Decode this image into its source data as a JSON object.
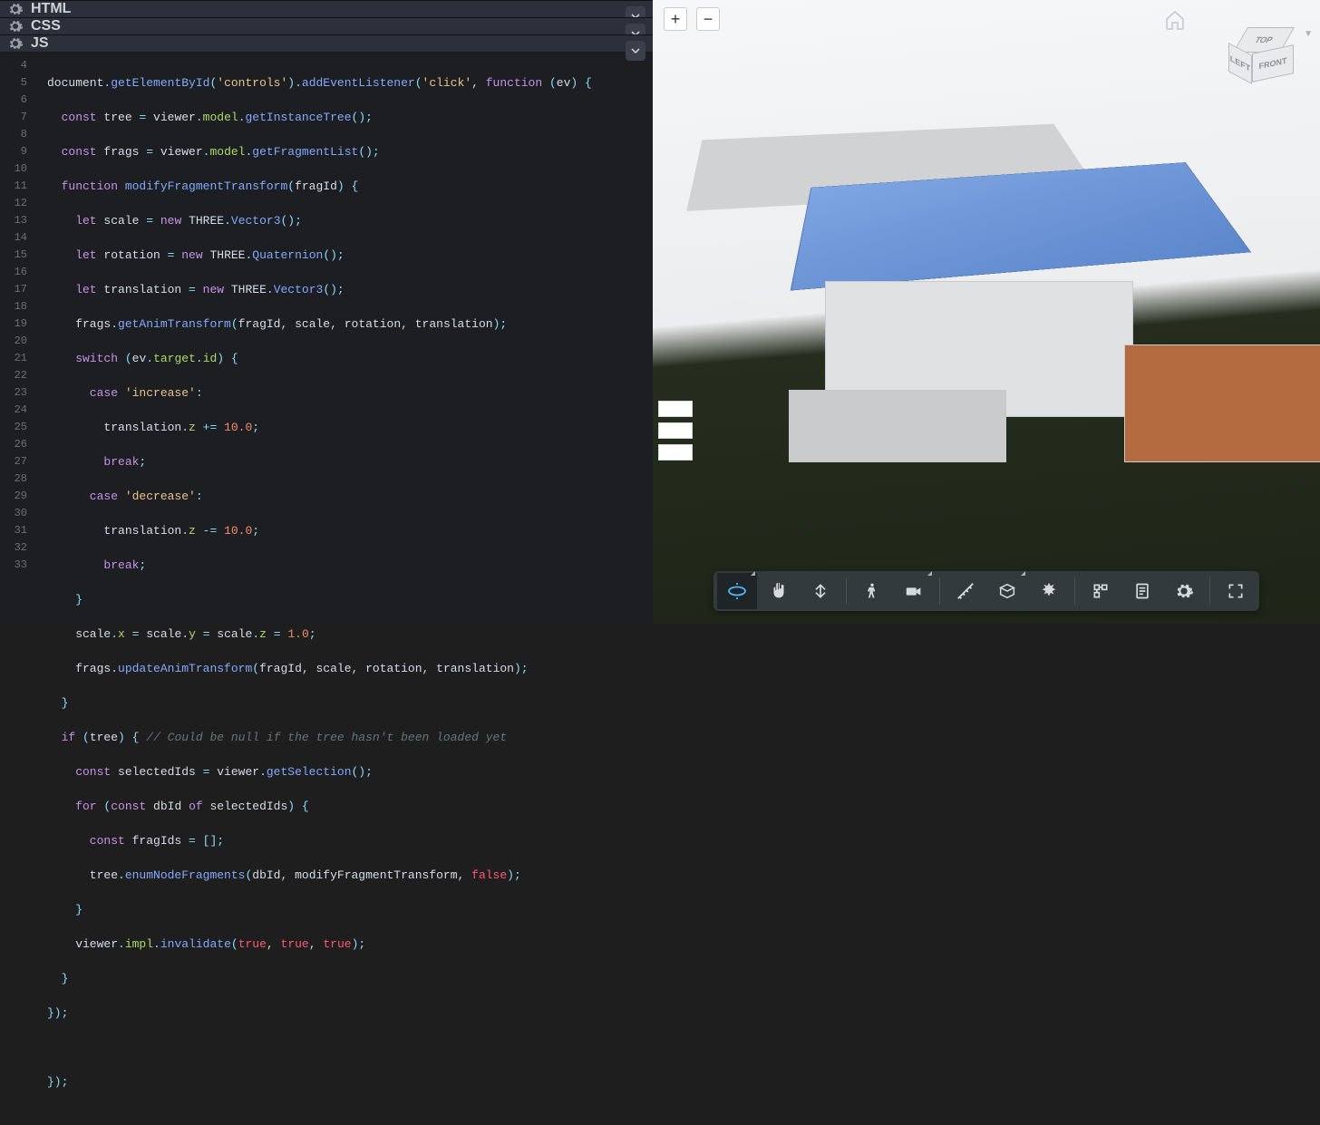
{
  "panels": {
    "html": "HTML",
    "css": "CSS",
    "js": "JS"
  },
  "zoom": {
    "plus": "+",
    "minus": "−"
  },
  "viewcube": {
    "top": "TOP",
    "left": "LEFT",
    "front": "FRONT"
  },
  "lines": [
    "4",
    "5",
    "6",
    "7",
    "8",
    "9",
    "10",
    "11",
    "12",
    "13",
    "14",
    "15",
    "16",
    "17",
    "18",
    "19",
    "20",
    "21",
    "22",
    "23",
    "24",
    "25",
    "26",
    "27",
    "28",
    "29",
    "30",
    "31",
    "32",
    "33"
  ],
  "code": {
    "l4a": "document",
    "l4b": ".",
    "l4c": "getElementById",
    "l4d": "(",
    "l4e": "'controls'",
    "l4f": ").",
    "l4g": "addEventListener",
    "l4h": "(",
    "l4i": "'click'",
    "l4j": ", ",
    "l4k": "function",
    "l4l": " (",
    "l4m": "ev",
    "l4n": ") {",
    "l5a": "  const ",
    "l5b": "tree ",
    "l5c": "= ",
    "l5d": "viewer",
    "l5e": ".",
    "l5f": "model",
    "l5g": ".",
    "l5h": "getInstanceTree",
    "l5i": "();",
    "l6a": "  const ",
    "l6b": "frags ",
    "l6c": "= ",
    "l6d": "viewer",
    "l6e": ".",
    "l6f": "model",
    "l6g": ".",
    "l6h": "getFragmentList",
    "l6i": "();",
    "l7a": "  function ",
    "l7b": "modifyFragmentTransform",
    "l7c": "(",
    "l7d": "fragId",
    "l7e": ") {",
    "l8a": "    let ",
    "l8b": "scale ",
    "l8c": "= ",
    "l8d": "new ",
    "l8e": "THREE",
    "l8f": ".",
    "l8g": "Vector3",
    "l8h": "();",
    "l9a": "    let ",
    "l9b": "rotation ",
    "l9c": "= ",
    "l9d": "new ",
    "l9e": "THREE",
    "l9f": ".",
    "l9g": "Quaternion",
    "l9h": "();",
    "l10a": "    let ",
    "l10b": "translation ",
    "l10c": "= ",
    "l10d": "new ",
    "l10e": "THREE",
    "l10f": ".",
    "l10g": "Vector3",
    "l10h": "();",
    "l11a": "    frags",
    "l11b": ".",
    "l11c": "getAnimTransform",
    "l11d": "(",
    "l11e": "fragId",
    "l11f": ", ",
    "l11g": "scale",
    "l11h": ", ",
    "l11i": "rotation",
    "l11j": ", ",
    "l11k": "translation",
    "l11l": ");",
    "l12a": "    switch ",
    "l12b": "(",
    "l12c": "ev",
    "l12d": ".",
    "l12e": "target",
    "l12f": ".",
    "l12g": "id",
    "l12h": ") {",
    "l13a": "      case ",
    "l13b": "'increase'",
    "l13c": ":",
    "l14a": "        translation",
    "l14b": ".",
    "l14c": "z ",
    "l14d": "+= ",
    "l14e": "10.0",
    "l14f": ";",
    "l15a": "        break",
    "l15b": ";",
    "l16a": "      case ",
    "l16b": "'decrease'",
    "l16c": ":",
    "l17a": "        translation",
    "l17b": ".",
    "l17c": "z ",
    "l17d": "-= ",
    "l17e": "10.0",
    "l17f": ";",
    "l18a": "        break",
    "l18b": ";",
    "l19a": "    }",
    "l20a": "    scale",
    "l20b": ".",
    "l20c": "x ",
    "l20d": "= ",
    "l20e": "scale",
    "l20f": ".",
    "l20g": "y ",
    "l20h": "= ",
    "l20i": "scale",
    "l20j": ".",
    "l20k": "z ",
    "l20l": "= ",
    "l20m": "1.0",
    "l20n": ";",
    "l21a": "    frags",
    "l21b": ".",
    "l21c": "updateAnimTransform",
    "l21d": "(",
    "l21e": "fragId",
    "l21f": ", ",
    "l21g": "scale",
    "l21h": ", ",
    "l21i": "rotation",
    "l21j": ", ",
    "l21k": "translation",
    "l21l": ");",
    "l22a": "  }",
    "l23a": "  if ",
    "l23b": "(",
    "l23c": "tree",
    "l23d": ") { ",
    "l23e": "// Could be null if the tree hasn't been loaded yet",
    "l24a": "    const ",
    "l24b": "selectedIds ",
    "l24c": "= ",
    "l24d": "viewer",
    "l24e": ".",
    "l24f": "getSelection",
    "l24g": "();",
    "l25a": "    for ",
    "l25b": "(",
    "l25c": "const ",
    "l25d": "dbId ",
    "l25e": "of ",
    "l25f": "selectedIds",
    "l25g": ") {",
    "l26a": "      const ",
    "l26b": "fragIds ",
    "l26c": "= [];",
    "l27a": "      tree",
    "l27b": ".",
    "l27c": "enumNodeFragments",
    "l27d": "(",
    "l27e": "dbId",
    "l27f": ", ",
    "l27g": "modifyFragmentTransform",
    "l27h": ", ",
    "l27i": "false",
    "l27j": ");",
    "l28a": "    }",
    "l29a": "    viewer",
    "l29b": ".",
    "l29c": "impl",
    "l29d": ".",
    "l29e": "invalidate",
    "l29f": "(",
    "l29g": "true",
    "l29h": ", ",
    "l29i": "true",
    "l29j": ", ",
    "l29k": "true",
    "l29l": ");",
    "l30a": "  }",
    "l31a": "});",
    "l32a": "",
    "l33a": "});"
  }
}
